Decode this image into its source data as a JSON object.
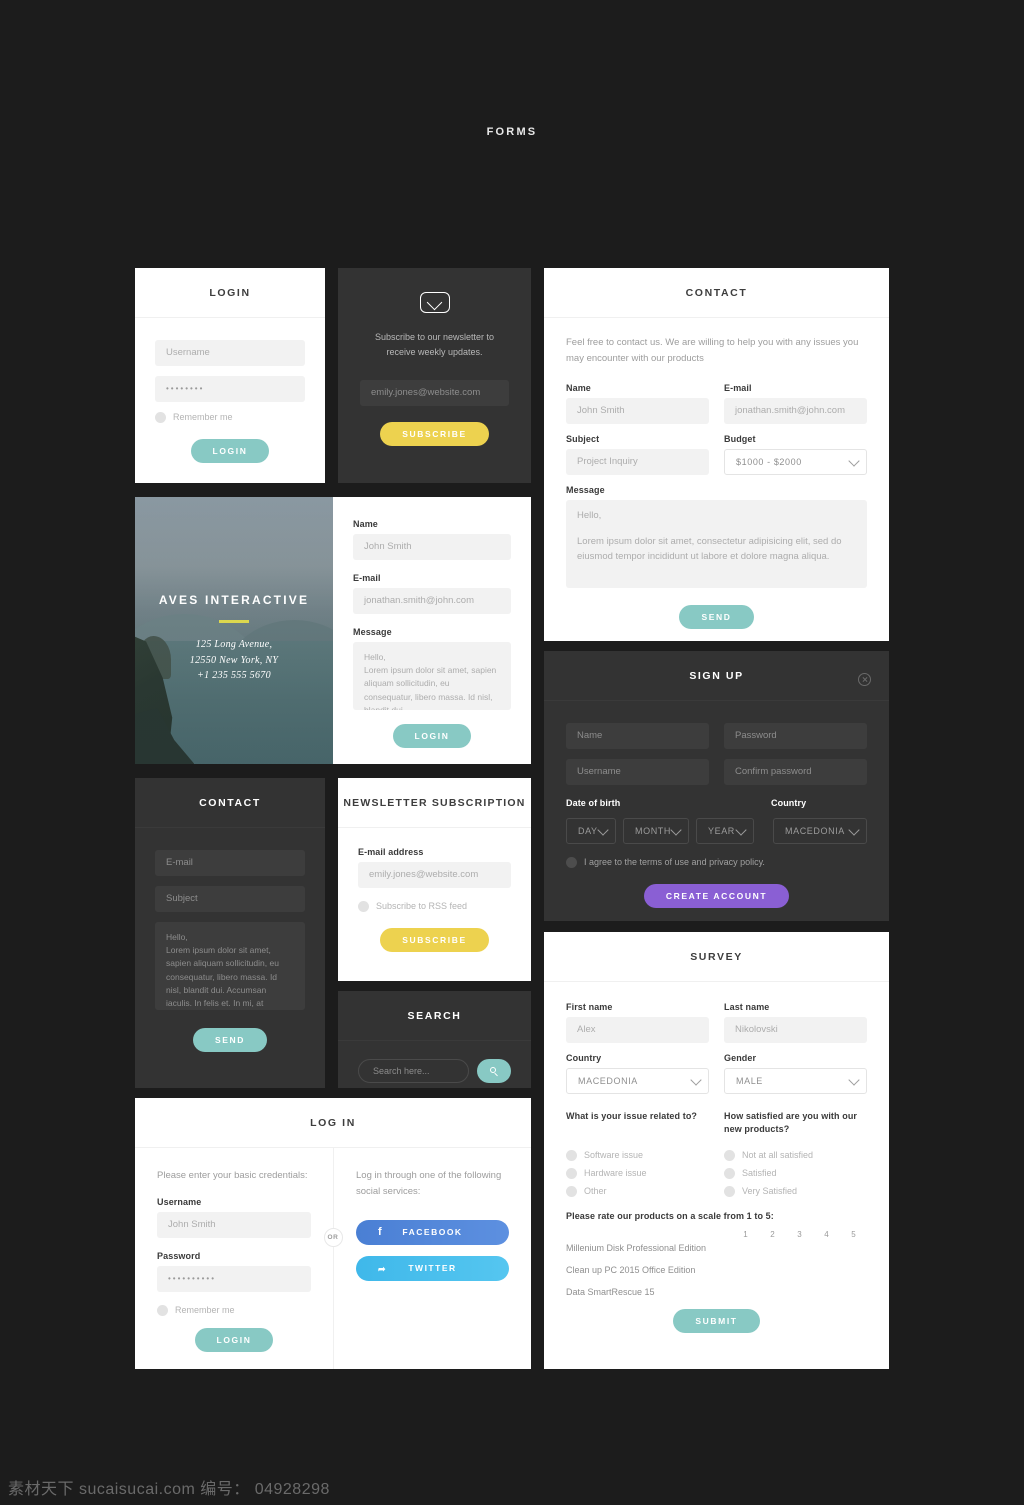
{
  "page": {
    "title": "FORMS",
    "watermark": "素材天下 sucaisucai.com  编号： 04928298"
  },
  "colors": {
    "teal": "#88c9c4",
    "yellow": "#edd24f",
    "purple": "#8a5fd4",
    "facebook": "#4a7fd4",
    "twitter": "#3fb8ea",
    "dark_card": "#333333",
    "background": "#1c1c1c"
  },
  "login_card": {
    "title": "LOGIN",
    "username_placeholder": "Username",
    "password_value": "••••••••",
    "remember_label": "Remember me",
    "submit_label": "LOGIN"
  },
  "newsletter_dark": {
    "icon": "mail-icon",
    "description": "Subscribe to our newsletter to receive weekly updates.",
    "email_placeholder": "emily.jones@website.com",
    "submit_label": "SUBSCRIBE"
  },
  "contact_light": {
    "title": "CONTACT",
    "intro": "Feel free to contact us. We are willing to help you with any issues you may encounter with our products",
    "name_label": "Name",
    "name_value": "John Smith",
    "email_label": "E-mail",
    "email_value": "jonathan.smith@john.com",
    "subject_label": "Subject",
    "subject_value": "Project Inquiry",
    "budget_label": "Budget",
    "budget_value": "$1000 - $2000",
    "message_label": "Message",
    "message_line1": "Hello,",
    "message_line2": "Lorem ipsum dolor sit amet, consectetur adipisicing elit, sed do eiusmod tempor incididunt ut labore et dolore magna aliqua.",
    "submit_label": "SEND"
  },
  "photo_contact": {
    "brand": "AVES INTERACTIVE",
    "address_line1": "125 Long Avenue,",
    "address_line2": "12550 New York, NY",
    "address_line3": "+1 235 555 5670",
    "name_label": "Name",
    "name_value": "John Smith",
    "email_label": "E-mail",
    "email_value": "jonathan.smith@john.com",
    "message_label": "Message",
    "message_line1": "Hello,",
    "message_line2": "Lorem ipsum dolor sit amet, sapien aliquam sollicitudin, eu consequatur, libero massa. Id nisl, blandit dui.",
    "submit_label": "LOGIN"
  },
  "contact_dark": {
    "title": "CONTACT",
    "email_placeholder": "E-mail",
    "subject_placeholder": "Subject",
    "message_line1": "Hello,",
    "message_line2": "Lorem ipsum dolor sit amet, sapien aliquam sollicitudin, eu consequatur, libero massa. Id nisl, blandit dui. Accumsan iaculis. In felis et. In mi, at",
    "submit_label": "SEND"
  },
  "newsletter_light": {
    "title": "NEWSLETTER SUBSCRIPTION",
    "email_label": "E-mail address",
    "email_placeholder": "emily.jones@website.com",
    "rss_label": "Subscribe to RSS feed",
    "submit_label": "SUBSCRIBE"
  },
  "search_card": {
    "title": "SEARCH",
    "placeholder": "Search here...",
    "button_icon": "search-icon"
  },
  "signup_card": {
    "title": "SIGN UP",
    "close_icon": "close-icon",
    "name_placeholder": "Name",
    "password_placeholder": "Password",
    "username_placeholder": "Username",
    "confirm_placeholder": "Confirm password",
    "dob_label": "Date of birth",
    "day_value": "DAY",
    "month_value": "MONTH",
    "year_value": "YEAR",
    "country_label": "Country",
    "country_value": "MACEDONIA",
    "terms_label": "I agree to the terms of use and privacy policy.",
    "submit_label": "CREATE ACCOUNT"
  },
  "survey_card": {
    "title": "SURVEY",
    "first_name_label": "First name",
    "first_name_value": "Alex",
    "last_name_label": "Last name",
    "last_name_value": "Nikolovski",
    "country_label": "Country",
    "country_value": "MACEDONIA",
    "gender_label": "Gender",
    "gender_value": "MALE",
    "issue_question": "What is your issue related to?",
    "issue_options": [
      "Software issue",
      "Hardware issue",
      "Other"
    ],
    "satisfaction_question": "How satisfied are you with our new products?",
    "satisfaction_options": [
      "Not at all satisfied",
      "Satisfied",
      "Very Satisfied"
    ],
    "rating_question": "Please rate our products on a scale from 1 to 5:",
    "scale": [
      "1",
      "2",
      "3",
      "4",
      "5"
    ],
    "products": [
      "Millenium Disk Professional Edition",
      "Clean up PC 2015 Office Edition",
      "Data SmartRescue 15"
    ],
    "submit_label": "SUBMIT"
  },
  "login_social_card": {
    "title": "LOG IN",
    "credentials_intro": "Please enter your basic credentials:",
    "username_label": "Username",
    "username_value": "John Smith",
    "password_label": "Password",
    "password_value": "••••••••••",
    "remember_label": "Remember me",
    "submit_label": "LOGIN",
    "social_intro": "Log in through one of the following social services:",
    "or_label": "OR",
    "facebook_label": "FACEBOOK",
    "facebook_icon": "facebook-icon",
    "twitter_label": "TWITTER",
    "twitter_icon": "twitter-icon"
  }
}
